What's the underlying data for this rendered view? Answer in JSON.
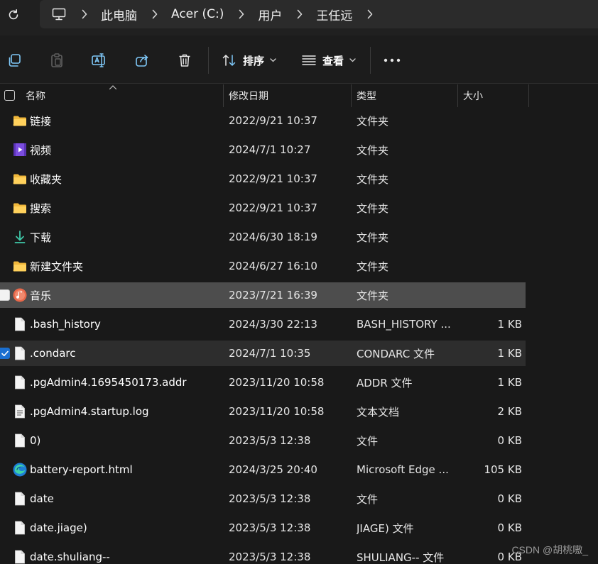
{
  "address_bar": {
    "crumbs": [
      "此电脑",
      "Acer (C:)",
      "用户",
      "王任远"
    ]
  },
  "command_bar": {
    "sort_label": "排序",
    "view_label": "查看"
  },
  "columns": {
    "name": "名称",
    "date": "修改日期",
    "type": "类型",
    "size": "大小"
  },
  "files": [
    {
      "name": "链接",
      "date": "2022/9/21 10:37",
      "type": "文件夹",
      "size": "",
      "icon": "folder-icon"
    },
    {
      "name": "视频",
      "date": "2024/7/1 10:27",
      "type": "文件夹",
      "size": "",
      "icon": "videos-folder-icon"
    },
    {
      "name": "收藏夹",
      "date": "2022/9/21 10:37",
      "type": "文件夹",
      "size": "",
      "icon": "folder-icon"
    },
    {
      "name": "搜索",
      "date": "2022/9/21 10:37",
      "type": "文件夹",
      "size": "",
      "icon": "folder-icon"
    },
    {
      "name": "下载",
      "date": "2024/6/30 18:19",
      "type": "文件夹",
      "size": "",
      "icon": "download-icon"
    },
    {
      "name": "新建文件夹",
      "date": "2024/6/27 16:10",
      "type": "文件夹",
      "size": "",
      "icon": "folder-icon"
    },
    {
      "name": "音乐",
      "date": "2023/7/21 16:39",
      "type": "文件夹",
      "size": "",
      "icon": "music-folder-icon",
      "state": "hover"
    },
    {
      "name": ".bash_history",
      "date": "2024/3/30 22:13",
      "type": "BASH_HISTORY ...",
      "size": "1 KB",
      "icon": "file-icon"
    },
    {
      "name": ".condarc",
      "date": "2024/7/1 10:35",
      "type": "CONDARC 文件",
      "size": "1 KB",
      "icon": "file-icon",
      "state": "checked"
    },
    {
      "name": ".pgAdmin4.1695450173.addr",
      "date": "2023/11/20 10:58",
      "type": "ADDR 文件",
      "size": "1 KB",
      "icon": "file-icon"
    },
    {
      "name": ".pgAdmin4.startup.log",
      "date": "2023/11/20 10:58",
      "type": "文本文档",
      "size": "2 KB",
      "icon": "text-file-icon"
    },
    {
      "name": "0)",
      "date": "2023/5/3 12:38",
      "type": "文件",
      "size": "0 KB",
      "icon": "file-icon"
    },
    {
      "name": "battery-report.html",
      "date": "2024/3/25 20:40",
      "type": "Microsoft Edge ...",
      "size": "105 KB",
      "icon": "edge-icon"
    },
    {
      "name": "date",
      "date": "2023/5/3 12:38",
      "type": "文件",
      "size": "0 KB",
      "icon": "file-icon"
    },
    {
      "name": "date.jiage)",
      "date": "2023/5/3 12:38",
      "type": "JIAGE) 文件",
      "size": "0 KB",
      "icon": "file-icon"
    },
    {
      "name": "date.shuliang--",
      "date": "2023/5/3 12:38",
      "type": "SHULIANG-- 文件",
      "size": "0 KB",
      "icon": "file-icon"
    }
  ],
  "watermark": "CSDN @胡桃嗷_"
}
